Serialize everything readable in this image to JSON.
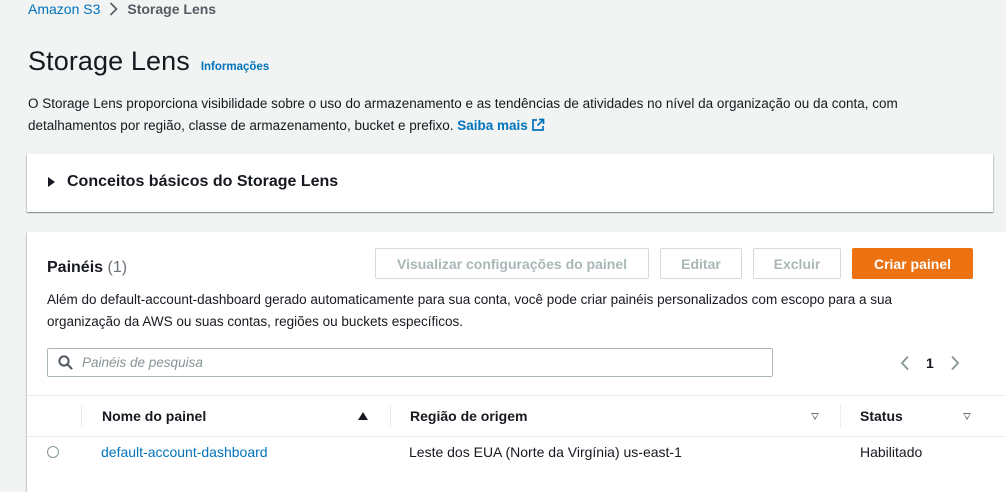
{
  "breadcrumb": {
    "root": "Amazon S3",
    "current": "Storage Lens"
  },
  "header": {
    "title": "Storage Lens",
    "info": "Informações"
  },
  "description": {
    "text": "O Storage Lens proporciona visibilidade sobre o uso do armazenamento e as tendências de atividades no nível da organização ou da conta, com detalhamentos por região, classe de armazenamento, bucket e prefixo.",
    "learn_more": "Saiba mais"
  },
  "concepts": {
    "title": "Conceitos básicos do Storage Lens"
  },
  "dashboards": {
    "title": "Painéis",
    "count": "(1)",
    "buttons": {
      "view_config": "Visualizar configurações do painel",
      "edit": "Editar",
      "delete": "Excluir",
      "create": "Criar painel"
    },
    "subtitle": "Além do default-account-dashboard gerado automaticamente para sua conta, você pode criar painéis personalizados com escopo para a sua organização da AWS ou suas contas, regiões ou buckets específicos.",
    "search": {
      "placeholder": "Painéis de pesquisa",
      "value": ""
    },
    "pagination": {
      "current_page": "1"
    },
    "columns": {
      "name": "Nome do painel",
      "region": "Região de origem",
      "status": "Status"
    },
    "rows": [
      {
        "name": "default-account-dashboard",
        "region": "Leste dos EUA (Norte da Virgínia) us-east-1",
        "status": "Habilitado"
      }
    ]
  },
  "colors": {
    "accent": "#0073bb",
    "primary_button": "#ec7211",
    "background": "#f2f3f3"
  }
}
